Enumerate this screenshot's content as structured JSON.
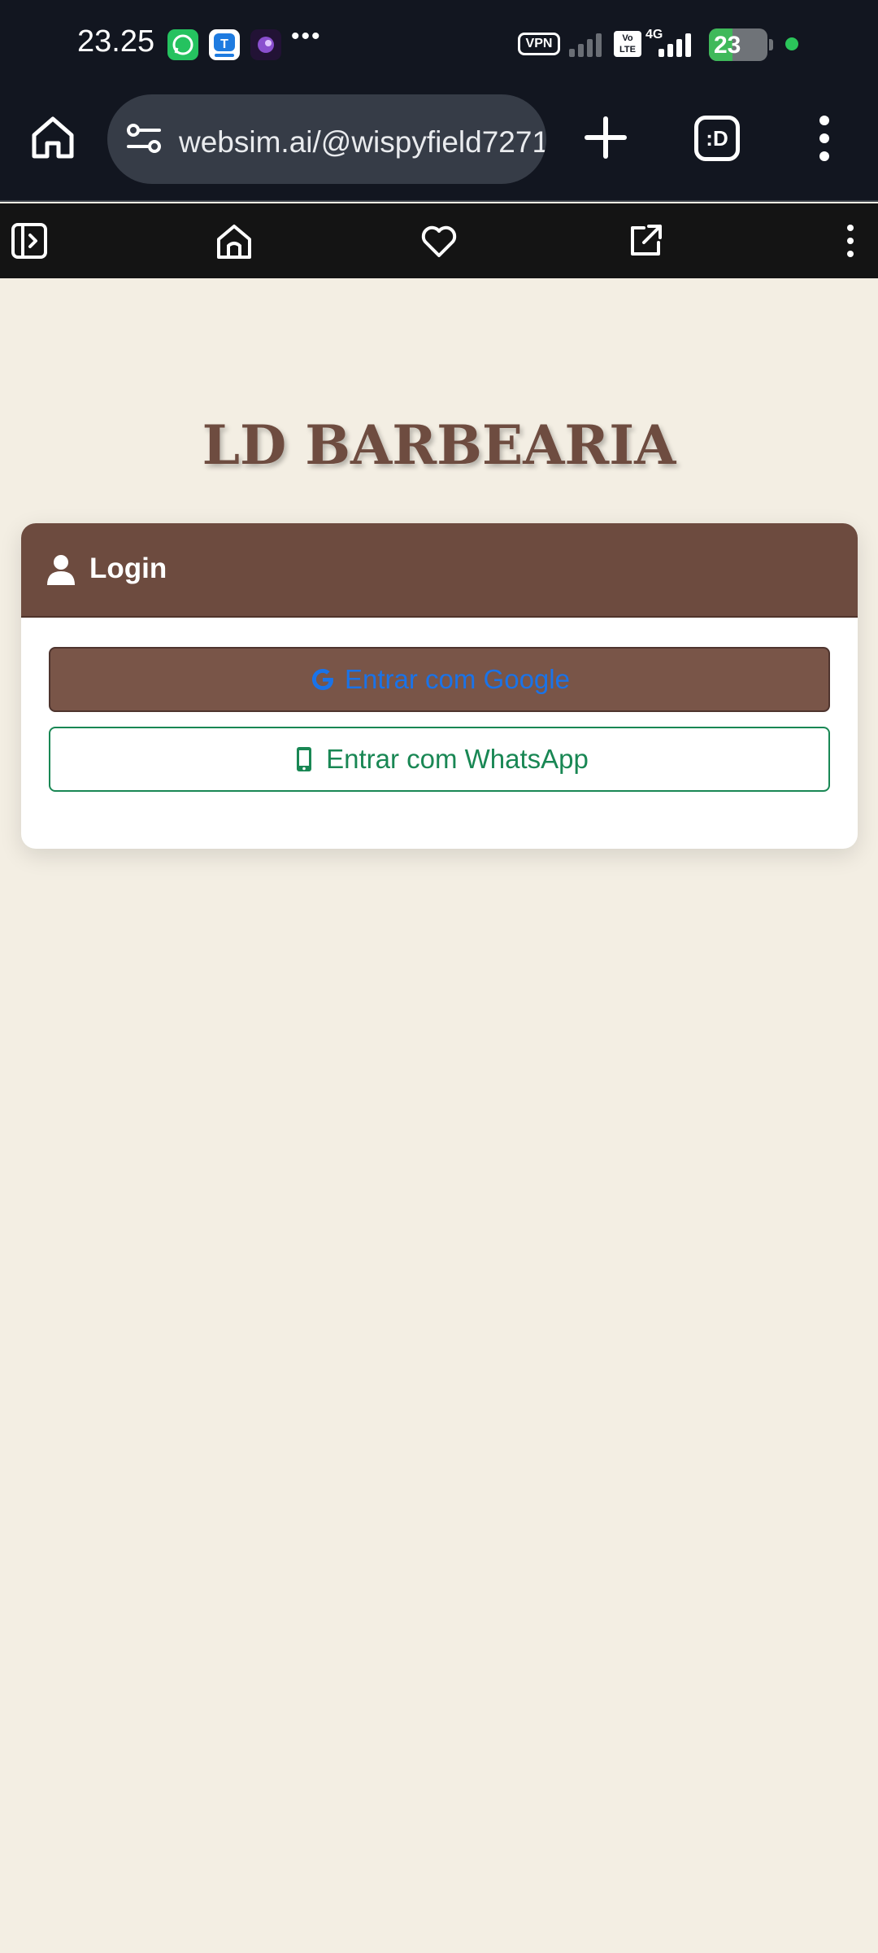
{
  "status_bar": {
    "time": "23.25",
    "notification_icons": [
      "whatsapp-icon",
      "app-notification-icon",
      "game-notification-icon"
    ],
    "more": "•••",
    "vpn_label": "VPN",
    "volte_label": "Vo LTE",
    "network_label": "4G",
    "battery_level": "23",
    "battery_charging": true
  },
  "browser": {
    "url": "websim.ai/@wispyfield7271",
    "tabs_label": ":D",
    "toolbar_icons": [
      "sidebar-toggle-icon",
      "home-icon",
      "heart-icon",
      "external-link-icon",
      "more-vertical-icon"
    ]
  },
  "page": {
    "title": "LD BARBEARIA",
    "login_card": {
      "header": "Login",
      "google_button": "Entrar com Google",
      "whatsapp_button": "Entrar com WhatsApp"
    }
  },
  "colors": {
    "background": "#f3eee3",
    "brown": "#6d4b3f",
    "google_blue": "#1a73e8",
    "whatsapp_green": "#198754"
  }
}
